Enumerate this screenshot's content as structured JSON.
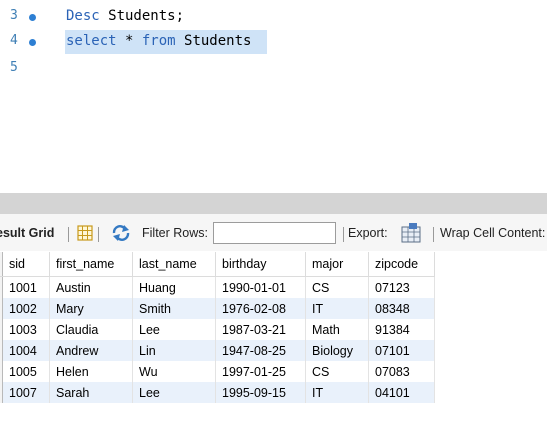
{
  "editor": {
    "lines": [
      {
        "number": "3",
        "keyword": "Desc",
        "rest": " Students;"
      },
      {
        "number": "4",
        "keyword1": "select",
        "mid": " * ",
        "keyword2": "from",
        "rest": " Students"
      },
      {
        "number": "5"
      }
    ]
  },
  "toolbar": {
    "result_grid_label": "esult Grid",
    "filter_rows_label": "Filter Rows:",
    "filter_value": "",
    "export_label": "Export:",
    "wrap_label": "Wrap Cell Content:"
  },
  "grid": {
    "columns": [
      "sid",
      "first_name",
      "last_name",
      "birthday",
      "major",
      "zipcode"
    ],
    "rows": [
      [
        "1001",
        "Austin",
        "Huang",
        "1990-01-01",
        "CS",
        "07123"
      ],
      [
        "1002",
        "Mary",
        "Smith",
        "1976-02-08",
        "IT",
        "08348"
      ],
      [
        "1003",
        "Claudia",
        "Lee",
        "1987-03-21",
        "Math",
        "91384"
      ],
      [
        "1004",
        "Andrew",
        "Lin",
        "1947-08-25",
        "Biology",
        "07101"
      ],
      [
        "1005",
        "Helen",
        "Wu",
        "1997-01-25",
        "CS",
        "07083"
      ],
      [
        "1007",
        "Sarah",
        "Lee",
        "1995-09-15",
        "IT",
        "04101"
      ]
    ]
  },
  "colors": {
    "keyword": "#2b63b6",
    "line_number": "#3f7fb5",
    "selection": "#cfe3f7",
    "row_alt": "#e9f1fb"
  }
}
